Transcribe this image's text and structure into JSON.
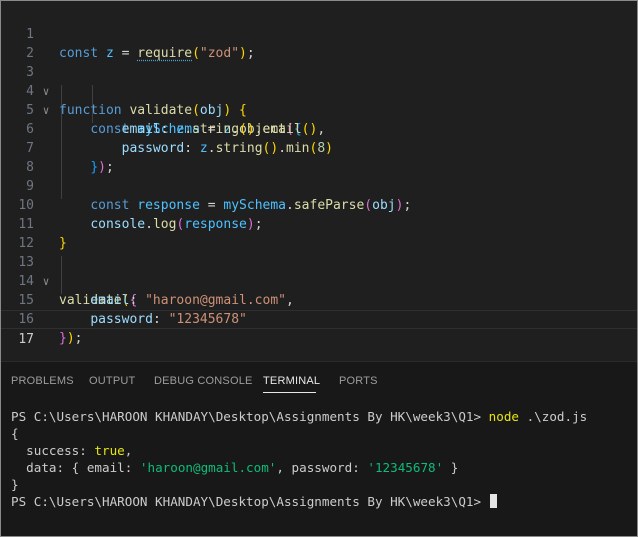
{
  "editor": {
    "lines": [
      {
        "n": "1"
      },
      {
        "n": "2"
      },
      {
        "n": "3"
      },
      {
        "n": "4"
      },
      {
        "n": "5"
      },
      {
        "n": "6"
      },
      {
        "n": "7"
      },
      {
        "n": "8"
      },
      {
        "n": "9"
      },
      {
        "n": "10"
      },
      {
        "n": "11"
      },
      {
        "n": "12"
      },
      {
        "n": "13"
      },
      {
        "n": "14"
      },
      {
        "n": "15"
      },
      {
        "n": "16"
      },
      {
        "n": "17"
      }
    ],
    "tokens": {
      "const": "const",
      "function": "function",
      "z": "z",
      "require": "require",
      "zod_str": "\"zod\"",
      "validate": "validate",
      "obj": "obj",
      "mySchema": "mySchema",
      "object": "object",
      "email": "email",
      "string": "string",
      "password": "password",
      "min": "min",
      "eight": "8",
      "response": "response",
      "safeParse": "safeParse",
      "console": "console",
      "log": "log",
      "email_str": "\"haroon@gmail.com\"",
      "pass_str": "\"12345678\""
    }
  },
  "panel": {
    "tabs": [
      "PROBLEMS",
      "OUTPUT",
      "DEBUG CONSOLE",
      "TERMINAL",
      "PORTS"
    ],
    "active_tab": "TERMINAL"
  },
  "terminal": {
    "prompt": "PS C:\\Users\\HAROON KHANDAY\\Desktop\\Assignments By HK\\week3\\Q1> ",
    "command_name": "node",
    "command_arg": " .\\zod.js",
    "out_open": "{",
    "success_key": "  success: ",
    "success_val": "true",
    "data_key": "  data: { email: ",
    "data_email": "'haroon@gmail.com'",
    "data_pass_key": ", password: ",
    "data_pass": "'12345678'",
    "data_close": " }",
    "out_close": "}",
    "prompt2": "PS C:\\Users\\HAROON KHANDAY\\Desktop\\Assignments By HK\\week3\\Q1> "
  }
}
